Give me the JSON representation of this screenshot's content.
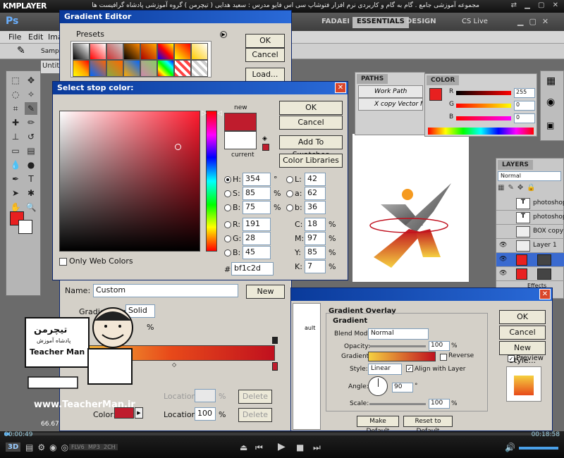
{
  "kmp": {
    "logo": "KMPLAYER",
    "title": "مجموعه آموزشی جامع . گام به گام و کاربردی نرم افزار فتوشاپ سی اس فایو   مدرس : سعید هدایی ( تیچرمن ) گروه آموزشی پادشاه گرافیست ها",
    "controls": "⇄ ▁ ▢ ✕",
    "time_elapsed": "00:00:49",
    "time_total": "00:18:58",
    "badges": [
      "FLV6",
      "MP3",
      "2CH"
    ],
    "btn_3d": "3D"
  },
  "ps": {
    "logo": "Ps",
    "menu": [
      "File",
      "Edit",
      "Ima"
    ],
    "workspaces": [
      "FADAEI",
      "ESSENTIALS",
      "DESIGN"
    ],
    "cslive": "CS Live",
    "opt_sample": "Sample",
    "doc_tab": "Untit",
    "zoom": "66.67%"
  },
  "paths": {
    "tab": "PATHS",
    "items": [
      "Work Path",
      "X copy Vector Mask"
    ]
  },
  "color_panel": {
    "tab": "COLOR",
    "channels": [
      {
        "label": "R",
        "value": "255"
      },
      {
        "label": "G",
        "value": "0"
      },
      {
        "label": "B",
        "value": "0"
      }
    ]
  },
  "layers": {
    "tab": "LAYERS",
    "blend": "Normal",
    "rows": [
      "photoshop",
      "photoshop",
      "BOX copy",
      "Layer 1",
      "",
      ""
    ],
    "effects": "Effects"
  },
  "gradient_editor": {
    "title": "Gradient Editor",
    "presets_label": "Presets",
    "ok": "OK",
    "cancel": "Cancel",
    "load": "Load...",
    "name_label": "Name:",
    "name_value": "Custom",
    "new": "New",
    "gradient_type_label": "Gradient Type:",
    "gradient_type": "Solid",
    "smoothness_value": "%",
    "location_label": "Location:",
    "pct": "%",
    "delete": "Delete",
    "color_label": "Color:",
    "location_value": "100"
  },
  "stop_color": {
    "title": "Select stop color:",
    "new_label": "new",
    "current_label": "current",
    "ok": "OK",
    "cancel": "Cancel",
    "add_swatches": "Add To Swatches",
    "color_libraries": "Color Libraries",
    "only_web": "Only Web Colors",
    "H": "354",
    "H_unit": "°",
    "S": "85",
    "B": "75",
    "R": "191",
    "G": "28",
    "Bv": "45",
    "L": "42",
    "a": "62",
    "b": "36",
    "C": "18",
    "M": "97",
    "Y": "85",
    "K": "7",
    "hex": "bf1c2d",
    "pct": "%",
    "labels": {
      "H": "H:",
      "S": "S:",
      "B": "B:",
      "R": "R:",
      "G": "G:",
      "Bl": "B:",
      "L": "L:",
      "a": "a:",
      "b": "b:",
      "C": "C:",
      "M": "M:",
      "Y": "Y:",
      "K": "K:",
      "hash": "#"
    }
  },
  "overlay": {
    "group_title": "Gradient Overlay",
    "sub_title": "Gradient",
    "blend_label": "Blend Mode:",
    "blend_value": "Normal",
    "opacity_label": "Opacity:",
    "opacity_value": "100",
    "gradient_label": "Gradient:",
    "reverse": "Reverse",
    "style_label": "Style:",
    "style_value": "Linear",
    "align": "Align with Layer",
    "angle_label": "Angle:",
    "angle_value": "90",
    "angle_unit": "°",
    "scale_label": "Scale:",
    "scale_value": "100",
    "pct": "%",
    "make_default": "Make Default",
    "reset_default": "Reset to Default",
    "ok": "OK",
    "cancel": "Cancel",
    "new_style": "New Style...",
    "preview": "Preview"
  },
  "teacher": {
    "brand_fa": "تیچرمن",
    "brand_fa_sub": "پادشاه آموزش",
    "brand_en": "Teacher Man",
    "url": "www.TeacherMan.ir"
  },
  "colors": {
    "stop_color": "#bf1c2d",
    "fg": "#e82020",
    "title_bar": "#0a3a9a"
  }
}
